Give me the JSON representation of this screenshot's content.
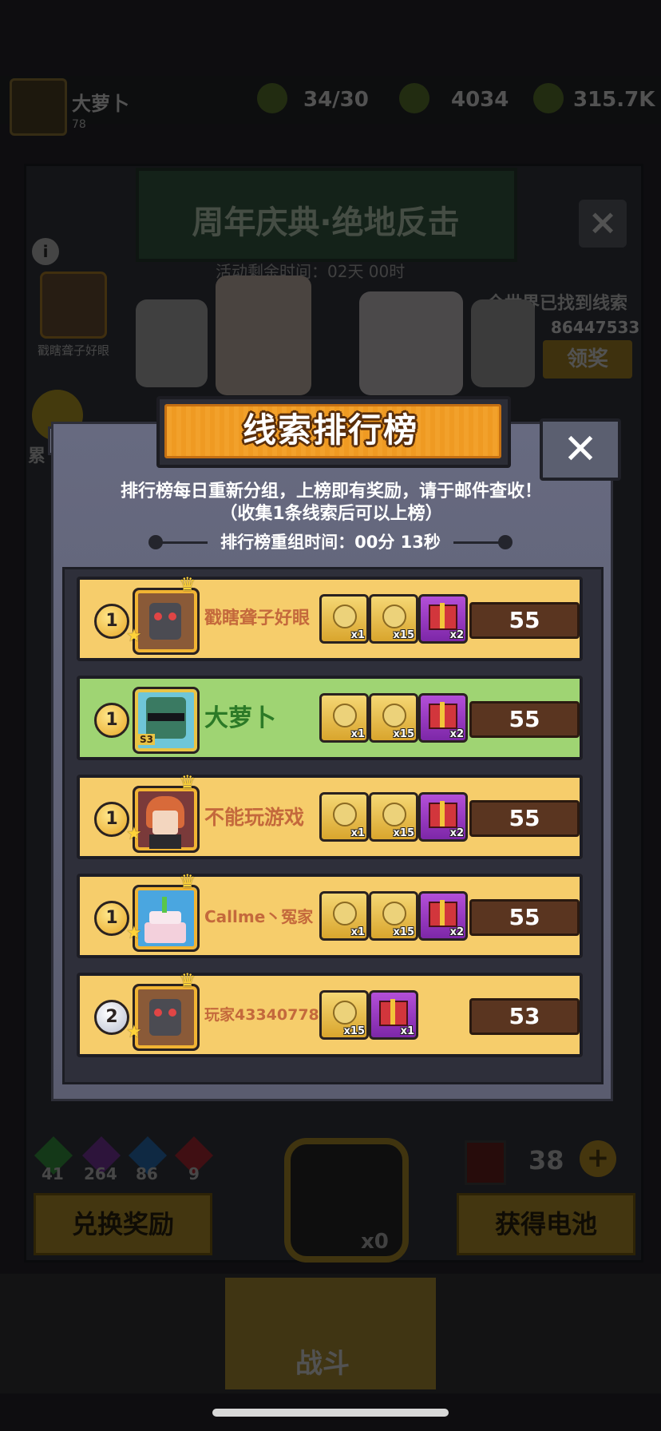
{
  "background": {
    "player_name": "大萝卜",
    "player_level": "78",
    "resource1": "34/30",
    "resource2": "4034",
    "resource3": "315.7K",
    "event_title": "周年庆典·绝地反击",
    "event_timer": "活动剩余时间：02天 00时",
    "world_found_label": "全世界已找到线索",
    "world_found_count": "86447533",
    "claim_label": "领奖",
    "side_player_name": "戳瞎聋子好眼",
    "side_label": "累",
    "gems": [
      "41",
      "264",
      "86",
      "9"
    ],
    "battery_count": "38",
    "exchange_label": "兑换奖励",
    "get_battery_label": "获得电池",
    "lock_count": "x0",
    "battle_label": "战斗"
  },
  "modal": {
    "title": "线索排行榜",
    "notice_line1": "排行榜每日重新分组，上榜即有奖励，请于邮件查收！",
    "notice_line2": "（收集1条线索后可以上榜）",
    "reset_text": "排行榜重组时间：00分 13秒",
    "rows": [
      {
        "rank": "1",
        "name": "戳瞎聋子好眼",
        "score": "55",
        "is_me": false,
        "rewards": [
          {
            "type": "gold",
            "count": "x1"
          },
          {
            "type": "gold",
            "count": "x15"
          },
          {
            "type": "purple",
            "count": "x2"
          }
        ]
      },
      {
        "rank": "1",
        "name": "大萝卜",
        "score": "55",
        "is_me": true,
        "season": "S3",
        "rewards": [
          {
            "type": "gold",
            "count": "x1"
          },
          {
            "type": "gold",
            "count": "x15"
          },
          {
            "type": "purple",
            "count": "x2"
          }
        ]
      },
      {
        "rank": "1",
        "name": "不能玩游戏",
        "score": "55",
        "is_me": false,
        "rewards": [
          {
            "type": "gold",
            "count": "x1"
          },
          {
            "type": "gold",
            "count": "x15"
          },
          {
            "type": "purple",
            "count": "x2"
          }
        ]
      },
      {
        "rank": "1",
        "name": "Callme丶冤家",
        "score": "55",
        "is_me": false,
        "rewards": [
          {
            "type": "gold",
            "count": "x1"
          },
          {
            "type": "gold",
            "count": "x15"
          },
          {
            "type": "purple",
            "count": "x2"
          }
        ]
      },
      {
        "rank": "2",
        "name": "玩家43340778",
        "score": "53",
        "is_me": false,
        "rewards": [
          {
            "type": "gold",
            "count": "x15"
          },
          {
            "type": "purple",
            "count": "x1"
          }
        ]
      }
    ]
  },
  "colors": {
    "row_bg": "#f6cd6b",
    "row_me_bg": "#9fd473",
    "title_orange": "#f2a12b",
    "score_bg": "#5a3520"
  }
}
